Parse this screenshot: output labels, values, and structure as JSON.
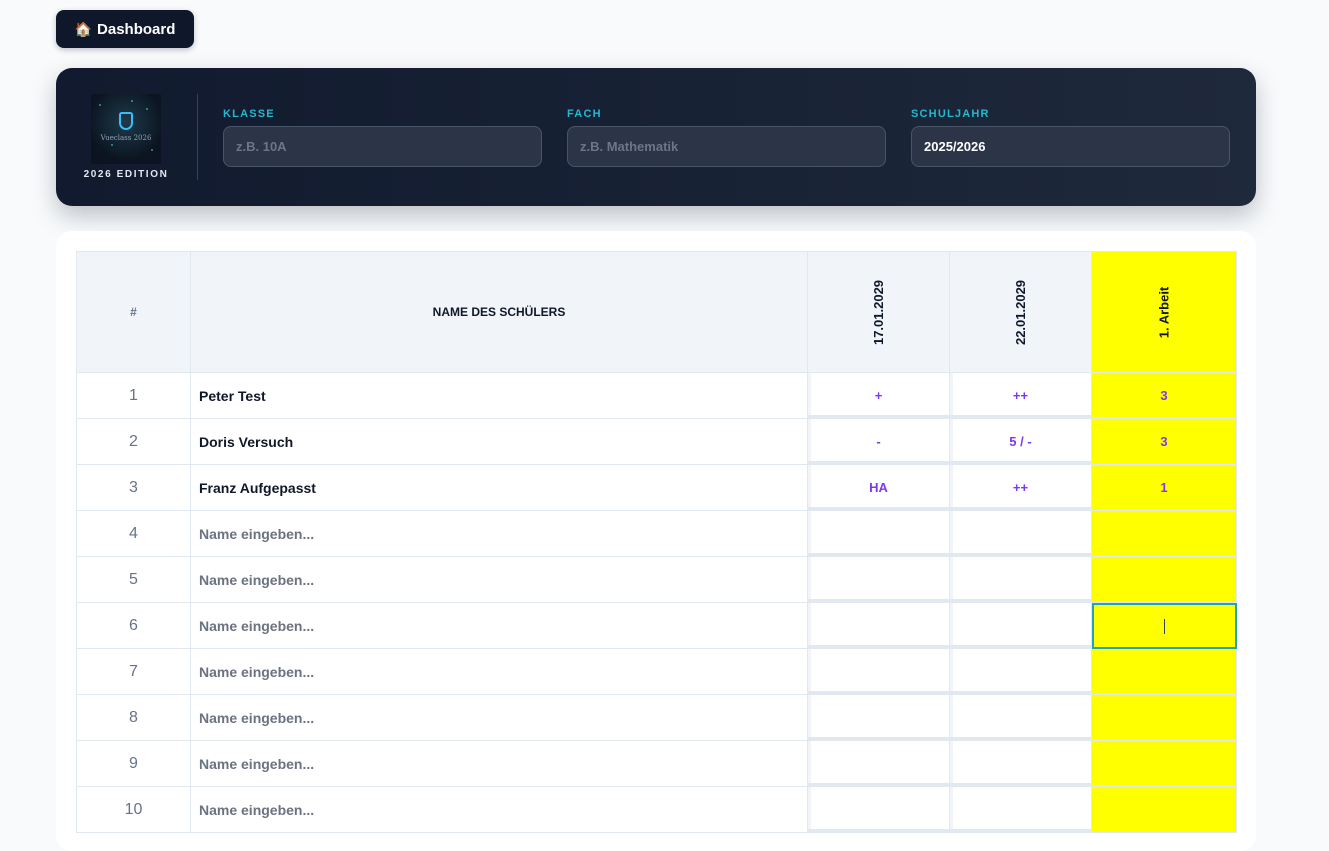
{
  "nav": {
    "dashboard_label": "Dashboard",
    "home_icon": "🏠"
  },
  "header": {
    "logo_text": "Vueclass 2026",
    "edition": "2026 EDITION",
    "klasse": {
      "label": "KLASSE",
      "value": "",
      "placeholder": "z.B. 10A"
    },
    "fach": {
      "label": "FACH",
      "value": "",
      "placeholder": "z.B. Mathematik"
    },
    "schuljahr": {
      "label": "SCHULJAHR",
      "value": "2025/2026",
      "placeholder": ""
    }
  },
  "table": {
    "col_num": "#",
    "col_name": "NAME DES SCHÜLERS",
    "dates": [
      "17.01.2029",
      "22.01.2029"
    ],
    "exam": "1. Arbeit",
    "name_placeholder": "Name eingeben...",
    "rows": [
      {
        "num": "1",
        "name": "Peter Test",
        "g1": "+",
        "g2": "++",
        "exam": "3"
      },
      {
        "num": "2",
        "name": "Doris Versuch",
        "g1": "-",
        "g2": "5 / -",
        "exam": "3"
      },
      {
        "num": "3",
        "name": "Franz Aufgepasst",
        "g1": "HA",
        "g2": "++",
        "exam": "1"
      },
      {
        "num": "4",
        "name": "",
        "g1": "",
        "g2": "",
        "exam": ""
      },
      {
        "num": "5",
        "name": "",
        "g1": "",
        "g2": "",
        "exam": ""
      },
      {
        "num": "6",
        "name": "",
        "g1": "",
        "g2": "",
        "exam": ""
      },
      {
        "num": "7",
        "name": "",
        "g1": "",
        "g2": "",
        "exam": ""
      },
      {
        "num": "8",
        "name": "",
        "g1": "",
        "g2": "",
        "exam": ""
      },
      {
        "num": "9",
        "name": "",
        "g1": "",
        "g2": "",
        "exam": ""
      },
      {
        "num": "10",
        "name": "",
        "g1": "",
        "g2": "",
        "exam": ""
      }
    ]
  },
  "colors": {
    "accent": "#22b8cf",
    "grade": "#7c3aed",
    "exam_bg": "#ffff00",
    "header_bg": "#111a2e"
  }
}
